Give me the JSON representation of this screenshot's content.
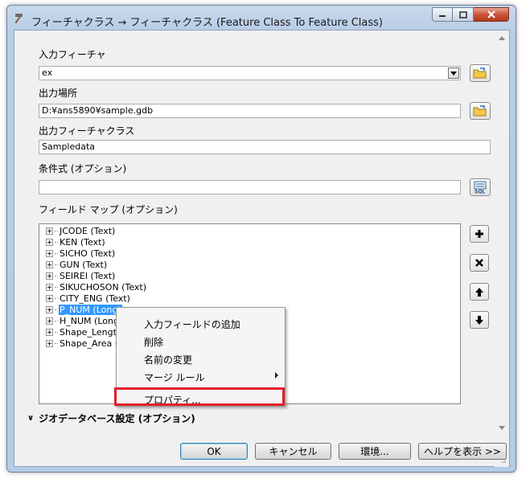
{
  "window": {
    "title": "フィーチャクラス → フィーチャクラス (Feature Class To Feature Class)"
  },
  "form": {
    "input_label": "入力フィーチャ",
    "input_value": "ex",
    "output_location_label": "出力場所",
    "output_location_value": "D:¥ans5890¥sample.gdb",
    "output_class_label": "出力フィーチャクラス",
    "output_class_value": "Sampledata",
    "expression_label": "条件式 (オプション)",
    "expression_value": "",
    "field_map_label": "フィールド マップ (オプション)"
  },
  "field_map": {
    "items": [
      {
        "label": "JCODE (Text)",
        "selected": false
      },
      {
        "label": "KEN (Text)",
        "selected": false
      },
      {
        "label": "SICHO (Text)",
        "selected": false
      },
      {
        "label": "GUN (Text)",
        "selected": false
      },
      {
        "label": "SEIREI (Text)",
        "selected": false
      },
      {
        "label": "SIKUCHOSON (Text)",
        "selected": false
      },
      {
        "label": "CITY_ENG (Text)",
        "selected": false
      },
      {
        "label": "P_NUM (Long)",
        "selected": true
      },
      {
        "label": "H_NUM (Long",
        "selected": false
      },
      {
        "label": "Shape_Length",
        "selected": false
      },
      {
        "label": "Shape_Area (",
        "selected": false
      }
    ]
  },
  "context_menu": {
    "items": [
      "入力フィールドの追加",
      "削除",
      "名前の変更",
      "マージ ルール",
      "プロパティ..."
    ]
  },
  "geodatabase_settings_label": "ジオデータベース設定 (オプション)",
  "buttons": {
    "ok": "OK",
    "cancel": "キャンセル",
    "environments": "環境...",
    "help": "ヘルプを表示 >>"
  },
  "colors": {
    "highlight_box": "#e0202a",
    "selection": "#3399ff"
  },
  "icons": [
    "hammer-icon",
    "minimize-icon",
    "maximize-icon",
    "close-icon",
    "folder-browse-icon",
    "sql-icon",
    "add-icon",
    "delete-icon",
    "move-up-icon",
    "move-down-icon"
  ]
}
